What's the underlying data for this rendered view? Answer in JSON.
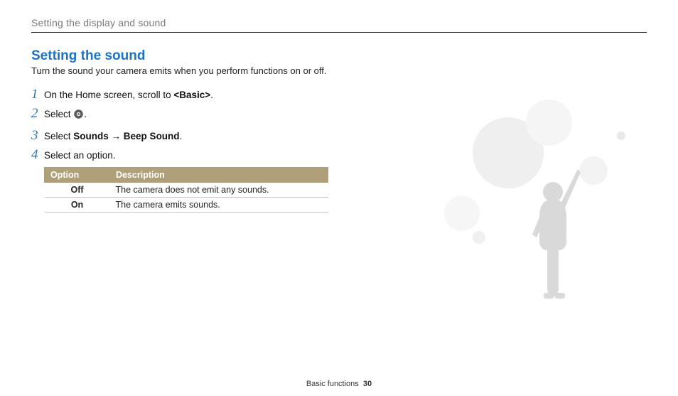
{
  "breadcrumb": "Setting the display and sound",
  "section_title": "Setting the sound",
  "intro": "Turn the sound your camera emits when you perform functions on or off.",
  "steps": {
    "s1": {
      "num": "1",
      "pre": "On the Home screen, scroll to ",
      "bold": "<Basic>",
      "post": "."
    },
    "s2": {
      "num": "2",
      "pre": "Select ",
      "post": "."
    },
    "s3": {
      "num": "3",
      "pre": "Select ",
      "b1": "Sounds",
      "arrow": " → ",
      "b2": "Beep Sound",
      "post": "."
    },
    "s4": {
      "num": "4",
      "text": "Select an option."
    }
  },
  "table": {
    "head_option": "Option",
    "head_desc": "Description",
    "rows": [
      {
        "option": "Off",
        "desc": "The camera does not emit any sounds."
      },
      {
        "option": "On",
        "desc": "The camera emits sounds."
      }
    ]
  },
  "footer": {
    "section": "Basic functions",
    "page": "30"
  },
  "icons": {
    "settings": "settings-gear"
  }
}
